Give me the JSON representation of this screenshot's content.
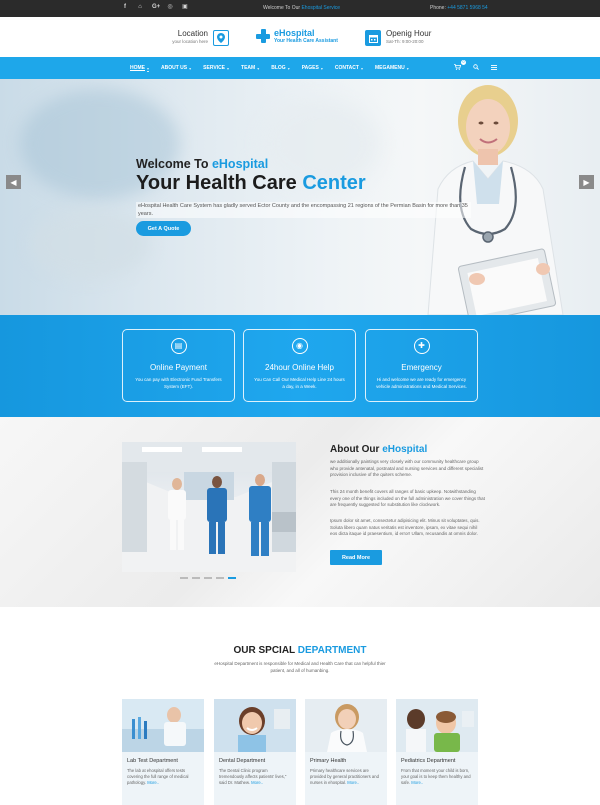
{
  "topbar": {
    "socials": [
      {
        "icon": "facebook-icon",
        "glyph": "f"
      },
      {
        "icon": "rss-icon",
        "glyph": "⌂"
      },
      {
        "icon": "google-plus-icon",
        "glyph": "G+"
      },
      {
        "icon": "dribbble-icon",
        "glyph": "◎"
      },
      {
        "icon": "instagram-icon",
        "glyph": "▣"
      }
    ],
    "welcome_prefix": "Welcome To Our",
    "welcome_brand": "Ehospital Service",
    "phone_label": "Phone:",
    "phone_number": "+44 5871 5968 54"
  },
  "header": {
    "location_title": "Location",
    "location_sub": "your location here",
    "brand_name": "eHospital",
    "brand_tagline": "Your Health Care Assistant",
    "hours_title": "Openig Hour",
    "hours_sub": "Sat-Th: 9:00-20:00"
  },
  "nav": {
    "items": [
      {
        "label": "HOME",
        "active": true
      },
      {
        "label": "ABOUT US"
      },
      {
        "label": "SERVICE"
      },
      {
        "label": "TEAM"
      },
      {
        "label": "BLOG"
      },
      {
        "label": "PAGES"
      },
      {
        "label": "CONTACT"
      },
      {
        "label": "MEGAMENU"
      }
    ],
    "cart_count": "0"
  },
  "hero": {
    "welcome_prefix": "Welcome To",
    "welcome_brand": "eHospital",
    "title_prefix": "Your Health Care",
    "title_highlight": "Center",
    "description": "eHospital Health Care System has gladly served Ector County and the encompassing 21 regions of the Permian Basin for more than 35 years.",
    "button": "Get A Quote"
  },
  "features": [
    {
      "title": "Online Payment",
      "text": "You can pay with Electronic Fund Transfers System (EFT).",
      "icon": "credit-card-icon",
      "glyph": "▤"
    },
    {
      "title": "24hour Online Help",
      "text": "You Can Call Our Medical Help Line 24 hours a day, in a Week.",
      "icon": "lifebuoy-icon",
      "glyph": "◉"
    },
    {
      "title": "Emergency",
      "text": "Hi and welcome we are ready for emergency vehicle administrations and Medical Services.",
      "icon": "ambulance-icon",
      "glyph": "✚"
    }
  ],
  "about": {
    "title_prefix": "About Our",
    "title_brand": "eHospital",
    "p1": "we additionally paintings very closely with our community healthcare group who provide antenatal, postnatal and nursing services and different specialist provision inclusive of the quiters scheme.",
    "p2": "This 24 month benefit covers all ranges of basic upkeep. Notwithstanding every one of the things included on the full administration we cover things that are frequently suggested for substitution like clockwork.",
    "p3": "Ipsum dolor sit amet, consectetur adipisicing elit. Minus sit voluptates, quis. Soluta libero quam natus veritatis est inventore, ipsam, ex vitae sequi nihil eos dicta itaque id praesentium, id error! Ullam, recusandis at omnis dolor.",
    "button": "Read More",
    "slides": 5,
    "active_slide": 5
  },
  "department": {
    "title_prefix": "OUR SPCIAL",
    "title_highlight": "DEPARTMENT",
    "subtitle": "eHospital Department is responsible for Medical and Health Care that can helpful thier patient, and all of humanbing.",
    "cards": [
      {
        "name": "Lab Test Department",
        "text": "The lab at ehospital offers tests covering the full range of medical pathology.",
        "more": "More.."
      },
      {
        "name": "Dental Department",
        "text": "The Dental Clinic program tremendously affects patients' lives,\" said Dr. Mathew.",
        "more": "More.."
      },
      {
        "name": "Primary Health",
        "text": "Primary healthcare services are provided by general practitioners and nurses in ehospital.",
        "more": "More.."
      },
      {
        "name": "Pediatrics Department",
        "text": "From that moment your child is born, your goal is to keep them healthy and safe.",
        "more": "More.."
      }
    ]
  },
  "colors": {
    "accent": "#1a9be0",
    "nav_bg": "#1ea7ea",
    "topbar_bg": "#2b2b2b"
  }
}
